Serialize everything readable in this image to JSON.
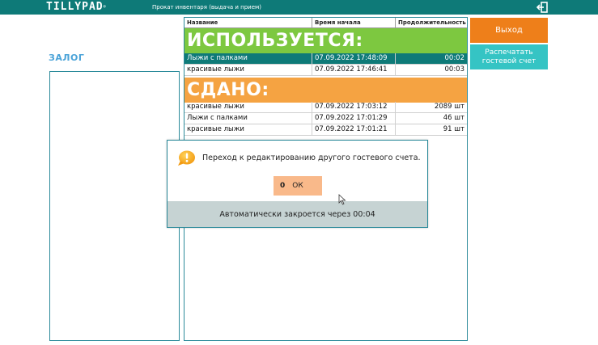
{
  "topbar": {
    "logo": "TILLYPAD",
    "logo_mark": "®",
    "title": "Прокат инвентаря (выдача и прием)"
  },
  "left_panel": {
    "title": "ЗАЛОГ"
  },
  "table": {
    "columns": [
      "Название",
      "Время начала",
      "Продолжительность"
    ],
    "section_used": "ИСПОЛЬЗУЕТСЯ:",
    "used_rows": [
      {
        "name": "Лыжи с палками",
        "start": "07.09.2022 17:48:09",
        "duration": "00:02",
        "selected": true
      },
      {
        "name": "красивые лыжи",
        "start": "07.09.2022 17:46:41",
        "duration": "00:03",
        "selected": false
      }
    ],
    "section_returned": "СДАНО:",
    "returned_rows": [
      {
        "name": "красивые лыжи",
        "start": "07.09.2022 17:03:12",
        "duration": "2089 шт"
      },
      {
        "name": "Лыжи с палками",
        "start": "07.09.2022 17:01:29",
        "duration": "46 шт"
      },
      {
        "name": "красивые лыжи",
        "start": "07.09.2022 17:01:21",
        "duration": "91 шт"
      }
    ]
  },
  "buttons": {
    "exit": "Выход",
    "print": "Распечатать гостевой счет"
  },
  "dialog": {
    "message": "Переход к редактированию другого гостевого счета.",
    "ok_hotkey": "0",
    "ok_label": "ОК",
    "footer": "Автоматически закроется через 00:04"
  },
  "colors": {
    "brand": "#0e7a78",
    "used": "#7dc840",
    "returned": "#f5a342",
    "exit": "#ee7f1a",
    "print": "#35c4c4"
  }
}
